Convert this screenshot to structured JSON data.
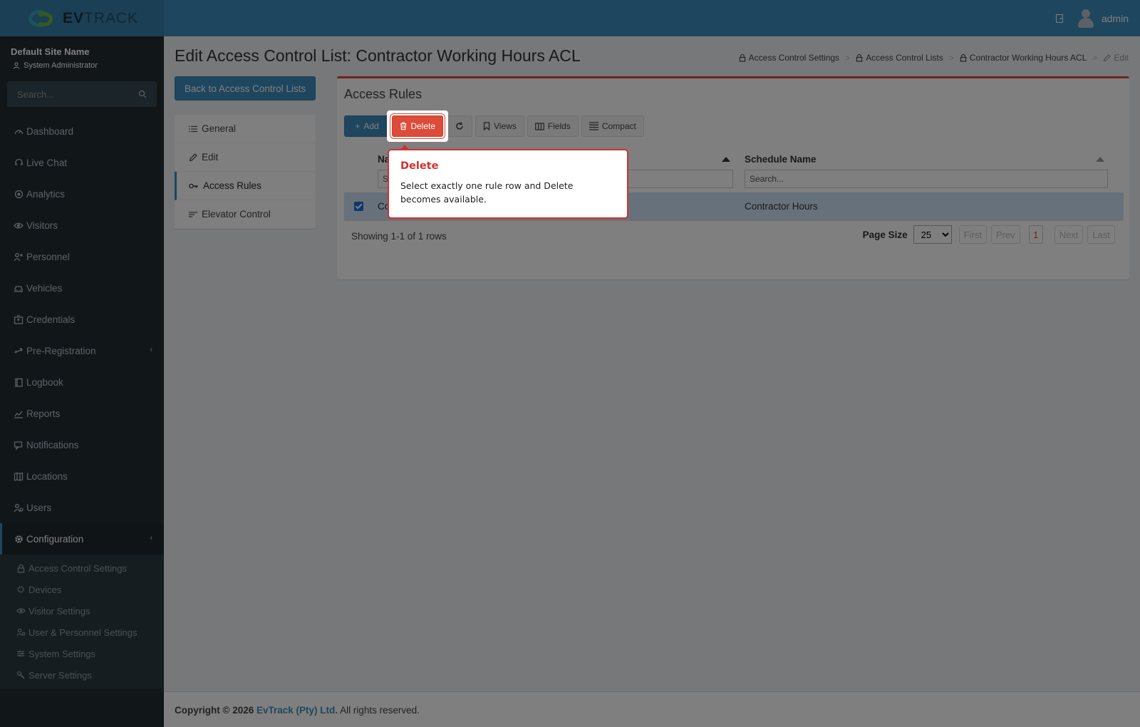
{
  "app": {
    "brand_ev": "EV",
    "brand_track": "TRACK",
    "user": "admin"
  },
  "sidebar": {
    "site_name": "Default Site Name",
    "role": "System Administrator",
    "search_placeholder": "Search...",
    "items": [
      {
        "label": "Dashboard",
        "icon": "dashboard-icon"
      },
      {
        "label": "Live Chat",
        "icon": "headset-icon"
      },
      {
        "label": "Analytics",
        "icon": "target-icon"
      },
      {
        "label": "Visitors",
        "icon": "eye-icon"
      },
      {
        "label": "Personnel",
        "icon": "people-icon"
      },
      {
        "label": "Vehicles",
        "icon": "car-icon"
      },
      {
        "label": "Credentials",
        "icon": "badge-icon"
      },
      {
        "label": "Pre-Registration",
        "icon": "arrows-icon"
      },
      {
        "label": "Logbook",
        "icon": "book-icon"
      },
      {
        "label": "Reports",
        "icon": "chart-icon"
      },
      {
        "label": "Notifications",
        "icon": "chat-icon"
      },
      {
        "label": "Locations",
        "icon": "map-icon"
      },
      {
        "label": "Users",
        "icon": "users-icon"
      },
      {
        "label": "Configuration",
        "icon": "gear-icon"
      }
    ],
    "sub_items": [
      {
        "label": "Access Control Settings",
        "icon": "lock-icon"
      },
      {
        "label": "Devices",
        "icon": "gear-icon"
      },
      {
        "label": "Visitor Settings",
        "icon": "eye-icon"
      },
      {
        "label": "User & Personnel Settings",
        "icon": "users-icon"
      },
      {
        "label": "System Settings",
        "icon": "sliders-icon"
      },
      {
        "label": "Server Settings",
        "icon": "wrench-icon"
      }
    ]
  },
  "page": {
    "title": "Edit Access Control List: Contractor Working Hours ACL",
    "breadcrumb": [
      "Access Control Settings",
      "Access Control Lists",
      "Contractor Working Hours ACL",
      "Edit"
    ],
    "back_button": "Back to Access Control Lists",
    "tabs": [
      "General",
      "Edit",
      "Access Rules",
      "Elevator Control"
    ]
  },
  "rules_box": {
    "title": "Access Rules",
    "toolbar": {
      "add": "Add",
      "delete": "Delete",
      "views": "Views",
      "fields": "Fields",
      "compact": "Compact"
    },
    "columns": {
      "name_header_visible": "Na",
      "schedule_header": "Schedule Name",
      "search_placeholder": "Search...",
      "name_search_visible": "S"
    },
    "row": {
      "name_visible": "Co",
      "schedule": "Contractor Hours"
    },
    "showing": "Showing 1-1 of 1 rows",
    "pager": {
      "page_size_label": "Page Size",
      "page_size": "25",
      "first": "First",
      "prev": "Prev",
      "current": "1",
      "next": "Next",
      "last": "Last"
    }
  },
  "tooltip": {
    "title": "Delete",
    "body": "Select exactly one rule row and Delete becomes available."
  },
  "footer": {
    "copyright": "Copyright © 2026",
    "company": "EvTrack (Pty) Ltd.",
    "rights": "All rights reserved."
  },
  "colors": {
    "header": "#3c8dbc",
    "sidebar": "#222d32",
    "danger": "#dd4b39",
    "tooltip_border": "#d32f2f"
  }
}
